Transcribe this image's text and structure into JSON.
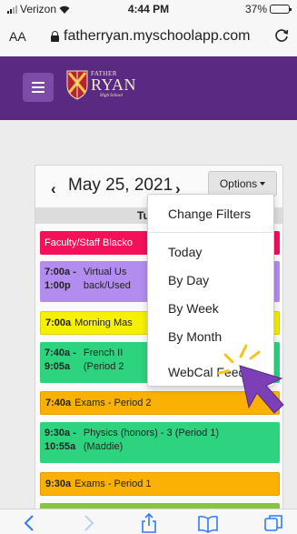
{
  "status_bar": {
    "carrier": "Verizon",
    "time": "4:44 PM",
    "battery": "37%",
    "battery_level": 0.37
  },
  "browser": {
    "text_size_label": "AA",
    "url": "fatherryan.myschoolapp.com"
  },
  "site": {
    "logo_line1": "FATHER",
    "logo_line2": "RYAN",
    "logo_line3": "High School",
    "brand_color": "#5a2a82"
  },
  "calendar": {
    "date": "May 25, 2021",
    "prev": "‹",
    "next": "›",
    "options_label": "Options",
    "day_header": "Tu",
    "events": [
      {
        "time": "",
        "title": "Faculty/Staff Blacko",
        "color": "#f5105a"
      },
      {
        "time_start": "7:00a -",
        "time_end": "1:00p",
        "title_1": "Virtual Us",
        "title_2": "back/Used",
        "color": "#b38cf0"
      },
      {
        "time": "7:00a",
        "title": "Morning Mas",
        "color": "#f6f002"
      },
      {
        "time_start": "7:40a -",
        "time_end": "9:05a",
        "title_1": "French II",
        "title_2": "(Period 2",
        "color": "#2dd37e"
      },
      {
        "time": "7:40a",
        "title": "Exams - Period 2",
        "color": "#fbb103"
      },
      {
        "time_start": "9:30a -",
        "time_end": "10:55a",
        "title_1": "Physics (honors) - 3 (Period 1)",
        "title_2": "(Maddie)",
        "color": "#2dd37e"
      },
      {
        "time": "9:30a",
        "title": "Exams - Period 1",
        "color": "#fbb103"
      },
      {
        "time": "",
        "title": "",
        "color": "#87c540"
      }
    ]
  },
  "options_menu": {
    "items": [
      "Change Filters",
      "Today",
      "By Day",
      "By Week",
      "By Month",
      "WebCal Feed"
    ]
  },
  "annotation": {
    "cursor_color": "#7c3fb8",
    "burst_color": "#f7c21a"
  }
}
